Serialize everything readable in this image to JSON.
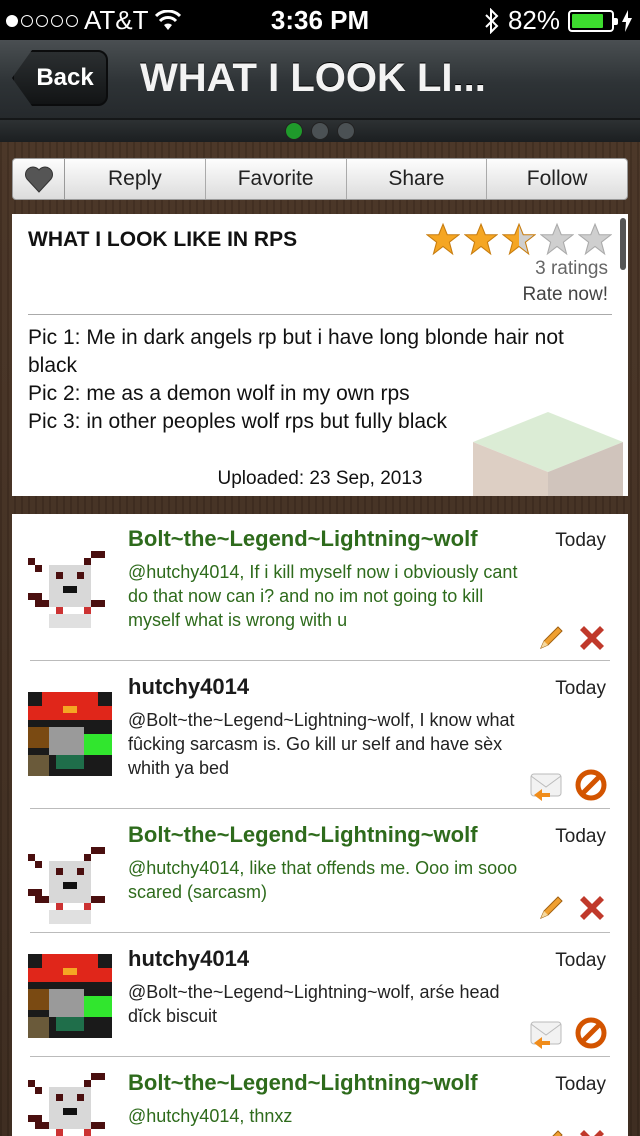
{
  "status_bar": {
    "carrier": "AT&T",
    "time": "3:36 PM",
    "battery": "82%",
    "battery_level": 0.82,
    "signal_bars": 1
  },
  "nav": {
    "back_label": "Back",
    "title": "WHAT I LOOK LI..."
  },
  "pager": {
    "count": 3,
    "active": 0
  },
  "actions": {
    "reply": "Reply",
    "favorite": "Favorite",
    "share": "Share",
    "follow": "Follow"
  },
  "post": {
    "title": "WHAT I LOOK LIKE IN RPS",
    "rating": 2.5,
    "rating_max": 5,
    "ratings_count": "3 ratings",
    "rate_now": "Rate now!",
    "body_lines": [
      "Pic 1: Me in dark angels rp but i have long blonde hair not black",
      "Pic 2: me as a demon wolf in my own rps",
      "Pic 3: in other peoples wolf rps but fully black"
    ],
    "uploaded": "Uploaded: 23 Sep, 2013"
  },
  "comments": [
    {
      "author": "Bolt~the~Legend~Lightning~wolf",
      "date": "Today",
      "text": "@hutchy4014, If i kill myself now i obviously cant do that now can i? and no im not going to kill myself what is wrong with u",
      "own": true,
      "avatar": "skull-avatar"
    },
    {
      "author": "hutchy4014",
      "date": "Today",
      "text": "@Bolt~the~Legend~Lightning~wolf, I know what fûcking sarcasm is. Go kill ur self and have sèx whith ya bed",
      "own": false,
      "avatar": "red-hat-avatar"
    },
    {
      "author": "Bolt~the~Legend~Lightning~wolf",
      "date": "Today",
      "text": "@hutchy4014, like that offends me. Ooo im sooo scared (sarcasm)",
      "own": true,
      "avatar": "skull-avatar"
    },
    {
      "author": "hutchy4014",
      "date": "Today",
      "text": "@Bolt~the~Legend~Lightning~wolf, arśe head dĭck biscuit",
      "own": false,
      "avatar": "red-hat-avatar"
    },
    {
      "author": "Bolt~the~Legend~Lightning~wolf",
      "date": "Today",
      "text": "@hutchy4014, thnxz",
      "own": true,
      "avatar": "skull-avatar"
    }
  ],
  "colors": {
    "own_comment": "#2e6b1c",
    "other_comment": "#222222",
    "star": "#f5a623",
    "delete": "#c0392b",
    "block": "#d35400",
    "pager_active": "#1f9a2b"
  }
}
